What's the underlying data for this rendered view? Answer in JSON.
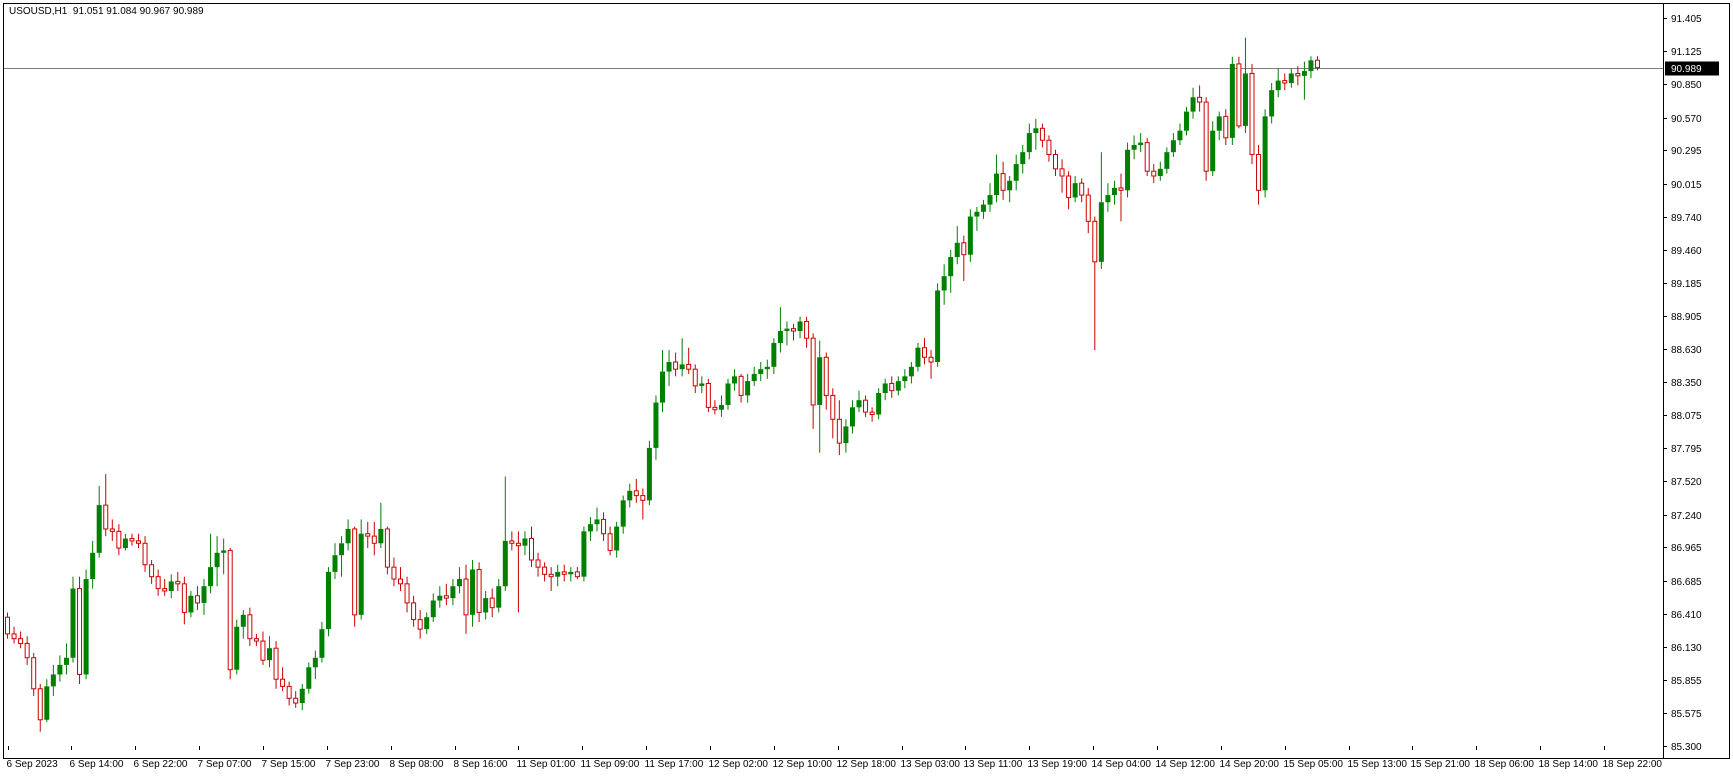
{
  "header": {
    "symbol": "USOUSD,H1",
    "ohlc": "91.051 91.084 90.967 90.989"
  },
  "colors": {
    "bull": "#008000",
    "bear": "#cc0000",
    "frame": "#000000",
    "price_line": "#808080",
    "price_box": "#000000",
    "price_text": "#ffffff"
  },
  "current_price_label": "90.989",
  "chart_data": {
    "type": "candlestick",
    "symbol": "USOUSD",
    "timeframe": "H1",
    "current_price": 90.989,
    "ylim": [
      85.3,
      91.405
    ],
    "y_ticks": [
      "91.405",
      "91.125",
      "90.850",
      "90.570",
      "90.295",
      "90.015",
      "89.740",
      "89.460",
      "89.185",
      "88.905",
      "88.630",
      "88.350",
      "88.075",
      "87.795",
      "87.520",
      "87.240",
      "86.965",
      "86.685",
      "86.410",
      "86.130",
      "85.855",
      "85.575",
      "85.300"
    ],
    "x_ticks": [
      "6 Sep 2023",
      "6 Sep 14:00",
      "6 Sep 22:00",
      "7 Sep 07:00",
      "7 Sep 15:00",
      "7 Sep 23:00",
      "8 Sep 08:00",
      "8 Sep 16:00",
      "11 Sep 01:00",
      "11 Sep 09:00",
      "11 Sep 17:00",
      "12 Sep 02:00",
      "12 Sep 10:00",
      "12 Sep 18:00",
      "13 Sep 03:00",
      "13 Sep 11:00",
      "13 Sep 19:00",
      "14 Sep 04:00",
      "14 Sep 12:00",
      "14 Sep 20:00",
      "15 Sep 05:00",
      "15 Sep 13:00",
      "15 Sep 21:00",
      "18 Sep 06:00",
      "18 Sep 14:00",
      "18 Sep 22:00"
    ],
    "candles": [
      [
        86.38,
        86.42,
        86.2,
        86.24
      ],
      [
        86.24,
        86.3,
        86.16,
        86.2
      ],
      [
        86.2,
        86.26,
        86.12,
        86.16
      ],
      [
        86.16,
        86.22,
        85.98,
        86.04
      ],
      [
        86.04,
        86.08,
        85.72,
        85.78
      ],
      [
        85.78,
        85.82,
        85.42,
        85.52
      ],
      [
        85.52,
        85.86,
        85.5,
        85.8
      ],
      [
        85.8,
        85.98,
        85.72,
        85.9
      ],
      [
        85.9,
        86.06,
        85.84,
        85.98
      ],
      [
        85.98,
        86.16,
        85.9,
        86.04
      ],
      [
        86.04,
        86.72,
        86.0,
        86.62
      ],
      [
        86.62,
        86.72,
        85.82,
        85.9
      ],
      [
        85.9,
        86.78,
        85.86,
        86.7
      ],
      [
        86.7,
        87.02,
        86.62,
        86.92
      ],
      [
        86.92,
        87.48,
        86.88,
        87.32
      ],
      [
        87.32,
        87.58,
        87.06,
        87.12
      ],
      [
        87.12,
        87.2,
        87.02,
        87.1
      ],
      [
        87.1,
        87.16,
        86.9,
        86.96
      ],
      [
        86.96,
        87.08,
        86.94,
        87.04
      ],
      [
        87.04,
        87.08,
        86.98,
        87.02
      ],
      [
        87.02,
        87.08,
        86.96,
        87.0
      ],
      [
        87.0,
        87.06,
        86.76,
        86.82
      ],
      [
        86.82,
        86.86,
        86.66,
        86.72
      ],
      [
        86.72,
        86.78,
        86.56,
        86.62
      ],
      [
        86.62,
        86.7,
        86.56,
        86.6
      ],
      [
        86.6,
        86.74,
        86.54,
        86.68
      ],
      [
        86.68,
        86.76,
        86.6,
        86.66
      ],
      [
        86.66,
        86.72,
        86.32,
        86.42
      ],
      [
        86.42,
        86.6,
        86.38,
        86.56
      ],
      [
        86.56,
        86.64,
        86.44,
        86.5
      ],
      [
        86.5,
        86.7,
        86.4,
        86.64
      ],
      [
        86.64,
        87.08,
        86.58,
        86.8
      ],
      [
        86.8,
        87.06,
        86.64,
        86.92
      ],
      [
        86.92,
        87.04,
        86.74,
        86.94
      ],
      [
        86.94,
        86.96,
        85.86,
        85.94
      ],
      [
        85.94,
        86.36,
        85.9,
        86.3
      ],
      [
        86.3,
        86.44,
        86.2,
        86.4
      ],
      [
        86.4,
        86.46,
        86.14,
        86.2
      ],
      [
        86.2,
        86.24,
        86.14,
        86.18
      ],
      [
        86.18,
        86.26,
        85.98,
        86.02
      ],
      [
        86.02,
        86.22,
        85.96,
        86.12
      ],
      [
        86.12,
        86.18,
        85.78,
        85.86
      ],
      [
        85.86,
        85.96,
        85.76,
        85.8
      ],
      [
        85.8,
        85.84,
        85.64,
        85.7
      ],
      [
        85.7,
        85.76,
        85.62,
        85.66
      ],
      [
        85.66,
        85.82,
        85.6,
        85.78
      ],
      [
        85.78,
        86.0,
        85.74,
        85.96
      ],
      [
        85.96,
        86.1,
        85.86,
        86.04
      ],
      [
        86.04,
        86.34,
        86.0,
        86.28
      ],
      [
        86.28,
        86.8,
        86.22,
        86.76
      ],
      [
        86.76,
        87.0,
        86.7,
        86.9
      ],
      [
        86.9,
        87.06,
        86.72,
        87.0
      ],
      [
        87.0,
        87.2,
        86.94,
        87.12
      ],
      [
        87.12,
        87.14,
        86.3,
        86.4
      ],
      [
        86.4,
        87.2,
        86.36,
        87.08
      ],
      [
        87.08,
        87.18,
        86.96,
        87.06
      ],
      [
        87.06,
        87.18,
        86.9,
        87.0
      ],
      [
        87.0,
        87.34,
        86.96,
        87.12
      ],
      [
        87.12,
        87.14,
        86.74,
        86.8
      ],
      [
        86.8,
        86.88,
        86.64,
        86.7
      ],
      [
        86.7,
        86.8,
        86.6,
        86.66
      ],
      [
        86.66,
        86.72,
        86.42,
        86.5
      ],
      [
        86.5,
        86.56,
        86.3,
        86.36
      ],
      [
        86.36,
        86.44,
        86.2,
        86.28
      ],
      [
        86.28,
        86.42,
        86.24,
        86.38
      ],
      [
        86.38,
        86.58,
        86.34,
        86.52
      ],
      [
        86.52,
        86.64,
        86.46,
        86.56
      ],
      [
        86.56,
        86.66,
        86.48,
        86.54
      ],
      [
        86.54,
        86.7,
        86.48,
        86.64
      ],
      [
        86.64,
        86.8,
        86.58,
        86.7
      ],
      [
        86.7,
        86.82,
        86.24,
        86.4
      ],
      [
        86.4,
        86.86,
        86.3,
        86.78
      ],
      [
        86.78,
        86.84,
        86.34,
        86.42
      ],
      [
        86.42,
        86.6,
        86.36,
        86.54
      ],
      [
        86.54,
        86.62,
        86.38,
        86.46
      ],
      [
        86.46,
        86.7,
        86.42,
        86.64
      ],
      [
        86.64,
        87.56,
        86.6,
        87.02
      ],
      [
        87.02,
        87.1,
        86.94,
        87.0
      ],
      [
        87.0,
        87.1,
        86.42,
        86.98
      ],
      [
        86.98,
        87.1,
        86.9,
        87.04
      ],
      [
        87.04,
        87.14,
        86.8,
        86.86
      ],
      [
        86.86,
        86.92,
        86.72,
        86.8
      ],
      [
        86.8,
        86.84,
        86.68,
        86.74
      ],
      [
        86.74,
        86.8,
        86.6,
        86.72
      ],
      [
        86.72,
        86.82,
        86.64,
        86.76
      ],
      [
        86.76,
        86.82,
        86.68,
        86.74
      ],
      [
        86.74,
        86.8,
        86.68,
        86.76
      ],
      [
        86.76,
        86.8,
        86.7,
        86.72
      ],
      [
        86.72,
        87.14,
        86.68,
        87.1
      ],
      [
        87.1,
        87.22,
        87.02,
        87.16
      ],
      [
        87.16,
        87.3,
        87.1,
        87.2
      ],
      [
        87.2,
        87.26,
        87.02,
        87.08
      ],
      [
        87.08,
        87.14,
        86.9,
        86.94
      ],
      [
        86.94,
        87.18,
        86.88,
        87.14
      ],
      [
        87.14,
        87.4,
        87.08,
        87.36
      ],
      [
        87.36,
        87.5,
        87.3,
        87.44
      ],
      [
        87.44,
        87.54,
        87.34,
        87.4
      ],
      [
        87.4,
        87.46,
        87.2,
        87.36
      ],
      [
        87.36,
        87.86,
        87.32,
        87.8
      ],
      [
        87.8,
        88.24,
        87.7,
        88.18
      ],
      [
        88.18,
        88.62,
        88.1,
        88.44
      ],
      [
        88.44,
        88.62,
        88.32,
        88.52
      ],
      [
        88.52,
        88.6,
        88.4,
        88.46
      ],
      [
        88.46,
        88.72,
        88.4,
        88.5
      ],
      [
        88.5,
        88.64,
        88.42,
        88.46
      ],
      [
        88.46,
        88.5,
        88.26,
        88.32
      ],
      [
        88.32,
        88.4,
        88.26,
        88.34
      ],
      [
        88.34,
        88.38,
        88.1,
        88.14
      ],
      [
        88.14,
        88.2,
        88.08,
        88.12
      ],
      [
        88.12,
        88.24,
        88.06,
        88.16
      ],
      [
        88.16,
        88.38,
        88.12,
        88.34
      ],
      [
        88.34,
        88.46,
        88.28,
        88.4
      ],
      [
        88.4,
        88.42,
        88.18,
        88.24
      ],
      [
        88.24,
        88.42,
        88.18,
        88.36
      ],
      [
        88.36,
        88.48,
        88.32,
        88.42
      ],
      [
        88.42,
        88.52,
        88.36,
        88.46
      ],
      [
        88.46,
        88.54,
        88.38,
        88.48
      ],
      [
        88.48,
        88.72,
        88.42,
        88.68
      ],
      [
        88.68,
        88.98,
        88.6,
        88.78
      ],
      [
        88.78,
        88.86,
        88.66,
        88.8
      ],
      [
        88.8,
        88.84,
        88.7,
        88.78
      ],
      [
        88.78,
        88.9,
        88.72,
        88.86
      ],
      [
        88.86,
        88.9,
        88.64,
        88.72
      ],
      [
        88.72,
        88.76,
        87.96,
        88.16
      ],
      [
        88.16,
        88.7,
        87.76,
        88.56
      ],
      [
        88.56,
        88.6,
        88.12,
        88.24
      ],
      [
        88.24,
        88.3,
        87.88,
        88.04
      ],
      [
        88.04,
        88.2,
        87.74,
        87.84
      ],
      [
        87.84,
        88.04,
        87.76,
        87.98
      ],
      [
        87.98,
        88.2,
        87.92,
        88.14
      ],
      [
        88.14,
        88.28,
        88.1,
        88.2
      ],
      [
        88.2,
        88.24,
        88.06,
        88.1
      ],
      [
        88.1,
        88.14,
        88.02,
        88.08
      ],
      [
        88.08,
        88.3,
        88.04,
        88.26
      ],
      [
        88.26,
        88.38,
        88.2,
        88.34
      ],
      [
        88.34,
        88.4,
        88.22,
        88.28
      ],
      [
        88.28,
        88.4,
        88.24,
        88.36
      ],
      [
        88.36,
        88.46,
        88.3,
        88.4
      ],
      [
        88.4,
        88.52,
        88.34,
        88.48
      ],
      [
        88.48,
        88.68,
        88.44,
        88.64
      ],
      [
        88.64,
        88.72,
        88.5,
        88.56
      ],
      [
        88.56,
        88.62,
        88.38,
        88.52
      ],
      [
        88.52,
        89.18,
        88.48,
        89.12
      ],
      [
        89.12,
        89.34,
        89.0,
        89.24
      ],
      [
        89.24,
        89.46,
        89.1,
        89.4
      ],
      [
        89.4,
        89.66,
        89.34,
        89.52
      ],
      [
        89.52,
        89.58,
        89.2,
        89.42
      ],
      [
        89.42,
        89.8,
        89.36,
        89.74
      ],
      [
        89.74,
        89.82,
        89.62,
        89.78
      ],
      [
        89.78,
        89.88,
        89.72,
        89.84
      ],
      [
        89.84,
        90.02,
        89.78,
        89.92
      ],
      [
        89.92,
        90.26,
        89.86,
        90.1
      ],
      [
        90.1,
        90.2,
        89.88,
        89.96
      ],
      [
        89.96,
        90.08,
        89.86,
        90.04
      ],
      [
        90.04,
        90.26,
        89.96,
        90.18
      ],
      [
        90.18,
        90.34,
        90.1,
        90.28
      ],
      [
        90.28,
        90.52,
        90.22,
        90.44
      ],
      [
        90.44,
        90.56,
        90.3,
        90.48
      ],
      [
        90.48,
        90.52,
        90.32,
        90.38
      ],
      [
        90.38,
        90.42,
        90.2,
        90.26
      ],
      [
        90.26,
        90.3,
        90.08,
        90.14
      ],
      [
        90.14,
        90.22,
        89.94,
        90.08
      ],
      [
        90.08,
        90.12,
        89.8,
        89.9
      ],
      [
        89.9,
        90.08,
        89.86,
        90.02
      ],
      [
        90.02,
        90.06,
        89.86,
        89.92
      ],
      [
        89.92,
        89.98,
        89.6,
        89.7
      ],
      [
        89.7,
        89.74,
        88.62,
        89.36
      ],
      [
        89.36,
        90.28,
        89.3,
        89.86
      ],
      [
        89.86,
        90.02,
        89.78,
        89.92
      ],
      [
        89.92,
        90.04,
        89.84,
        89.98
      ],
      [
        89.98,
        90.1,
        89.7,
        89.96
      ],
      [
        89.96,
        90.36,
        89.9,
        90.3
      ],
      [
        90.3,
        90.42,
        90.22,
        90.34
      ],
      [
        90.34,
        90.44,
        90.28,
        90.36
      ],
      [
        90.36,
        90.4,
        90.08,
        90.12
      ],
      [
        90.12,
        90.18,
        90.02,
        90.08
      ],
      [
        90.08,
        90.2,
        90.04,
        90.14
      ],
      [
        90.14,
        90.32,
        90.1,
        90.28
      ],
      [
        90.28,
        90.44,
        90.24,
        90.38
      ],
      [
        90.38,
        90.52,
        90.34,
        90.46
      ],
      [
        90.46,
        90.66,
        90.42,
        90.62
      ],
      [
        90.62,
        90.82,
        90.56,
        90.74
      ],
      [
        90.74,
        90.84,
        90.62,
        90.7
      ],
      [
        90.7,
        90.74,
        90.04,
        90.12
      ],
      [
        90.12,
        90.54,
        90.08,
        90.46
      ],
      [
        90.46,
        90.62,
        90.38,
        90.58
      ],
      [
        90.58,
        90.64,
        90.34,
        90.4
      ],
      [
        90.4,
        91.08,
        90.34,
        91.02
      ],
      [
        91.02,
        91.08,
        90.48,
        90.5
      ],
      [
        90.5,
        91.24,
        90.44,
        90.94
      ],
      [
        90.94,
        91.02,
        90.18,
        90.26
      ],
      [
        90.26,
        90.34,
        89.84,
        89.96
      ],
      [
        89.96,
        90.64,
        89.9,
        90.58
      ],
      [
        90.58,
        90.86,
        90.52,
        90.8
      ],
      [
        90.8,
        90.98,
        90.74,
        90.88
      ],
      [
        90.88,
        90.94,
        90.8,
        90.86
      ],
      [
        90.86,
        90.98,
        90.82,
        90.94
      ],
      [
        90.94,
        91.0,
        90.84,
        90.92
      ],
      [
        90.92,
        91.04,
        90.72,
        90.96
      ],
      [
        90.96,
        91.084,
        90.9,
        91.05
      ],
      [
        91.051,
        91.084,
        90.967,
        90.989
      ]
    ]
  }
}
